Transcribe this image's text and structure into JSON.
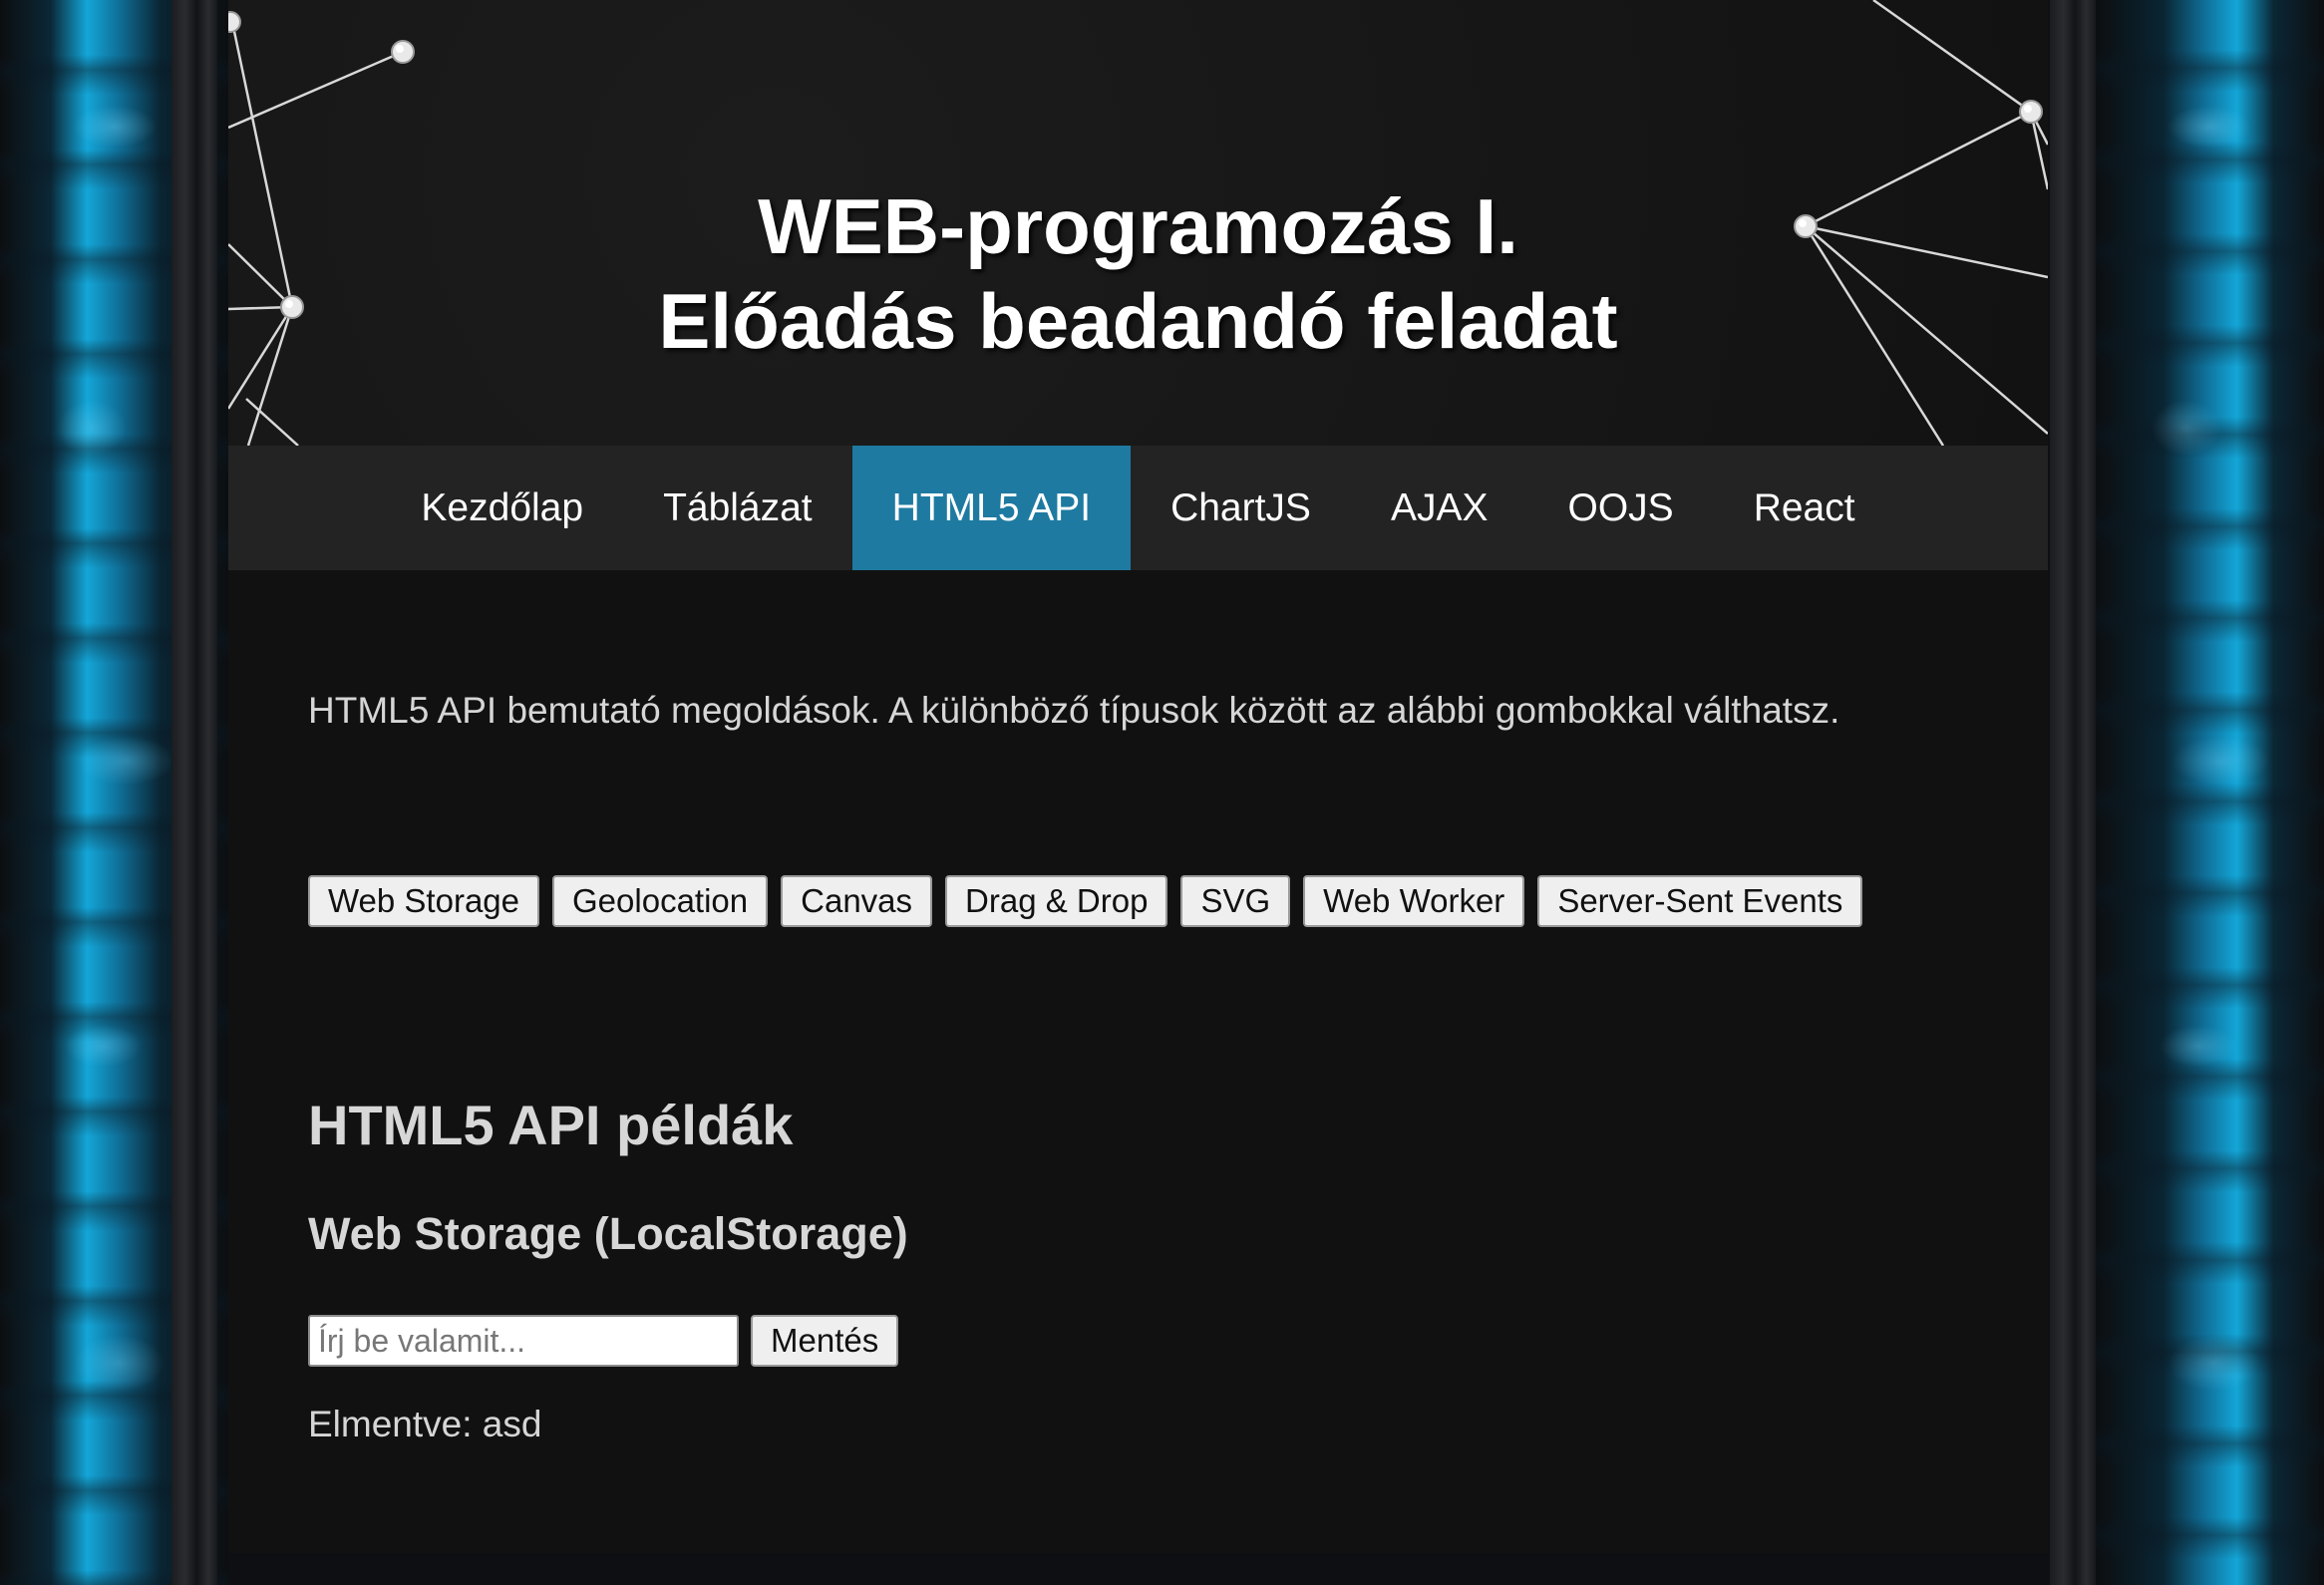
{
  "header": {
    "title_line1": "WEB-programozás I.",
    "title_line2": "Előadás beadandó feladat"
  },
  "nav": {
    "items": [
      {
        "label": "Kezdőlap"
      },
      {
        "label": "Táblázat"
      },
      {
        "label": "HTML5 API",
        "active": true
      },
      {
        "label": "ChartJS"
      },
      {
        "label": "AJAX"
      },
      {
        "label": "OOJS"
      },
      {
        "label": "React"
      }
    ]
  },
  "main": {
    "intro": "HTML5 API bemutató megoldások. A különböző típusok között az alábbi gombokkal válthatsz.",
    "api_buttons": [
      "Web Storage",
      "Geolocation",
      "Canvas",
      "Drag & Drop",
      "SVG",
      "Web Worker",
      "Server-Sent Events"
    ],
    "section_title": "HTML5 API példák",
    "subsection_title": "Web Storage (LocalStorage)",
    "storage": {
      "input_placeholder": "Írj be valamit...",
      "input_value": "",
      "save_label": "Mentés",
      "saved_text": "Elmentve: asd"
    }
  },
  "colors": {
    "nav_active": "#1e7aa1",
    "nav_bg": "#232323",
    "content_bg": "#111111",
    "side_glow": "#13a6d8"
  }
}
